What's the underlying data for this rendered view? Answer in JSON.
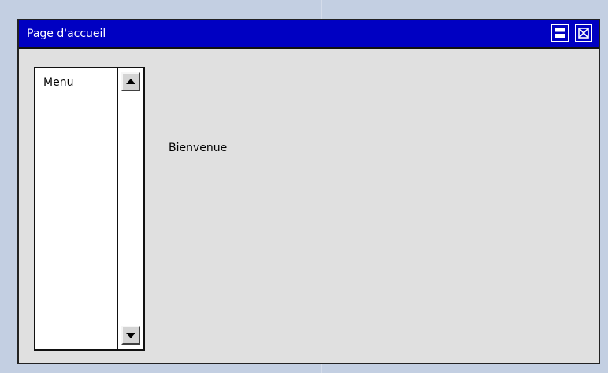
{
  "window": {
    "title": "Page d'accueil",
    "title_bar_color": "#0000c2",
    "background_color": "#e0e0e0",
    "buttons": [
      {
        "name": "maximize",
        "icon": "maximize-icon"
      },
      {
        "name": "close",
        "icon": "close-icon"
      }
    ]
  },
  "menu_list": {
    "items": [
      {
        "label": "Menu"
      }
    ],
    "scrollbar": {
      "up_icon": "arrow-up-icon",
      "down_icon": "arrow-down-icon"
    }
  },
  "main": {
    "welcome_text": "Bienvenue"
  }
}
